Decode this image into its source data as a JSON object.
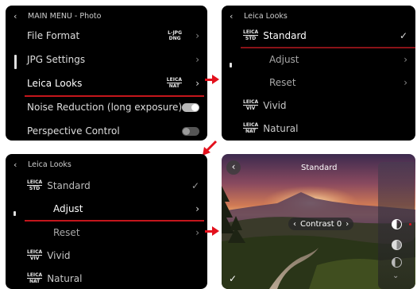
{
  "colors": {
    "accent_red": "#c4161c",
    "panel_bg": "#000000",
    "text": "#dedede"
  },
  "panel1": {
    "header": "MAIN MENU - Photo",
    "items": [
      {
        "label": "File Format",
        "value_top": "L-JPG",
        "value_bottom": "DNG",
        "control": "chevron"
      },
      {
        "label": "JPG Settings",
        "control": "chevron"
      },
      {
        "label": "Leica Looks",
        "value_top": "LEICA",
        "value_bottom": "NAT",
        "control": "chevron"
      },
      {
        "label": "Noise Reduction (long exposure)",
        "control": "toggle",
        "state": "on"
      },
      {
        "label": "Perspective Control",
        "control": "toggle",
        "state": "off"
      }
    ]
  },
  "panel2": {
    "header": "Leica Looks",
    "items": [
      {
        "label": "Standard",
        "badge_top": "LEICA",
        "badge_bottom": "STD",
        "control": "check"
      },
      {
        "label": "Adjust",
        "control": "chevron"
      },
      {
        "label": "Reset",
        "control": "chevron"
      },
      {
        "label": "Vivid",
        "badge_top": "LEICA",
        "badge_bottom": "VIV"
      },
      {
        "label": "Natural",
        "badge_top": "LEICA",
        "badge_bottom": "NAT"
      }
    ]
  },
  "panel3": {
    "header": "Leica Looks",
    "items": [
      {
        "label": "Standard",
        "badge_top": "LEICA",
        "badge_bottom": "STD",
        "control": "check"
      },
      {
        "label": "Adjust",
        "control": "chevron"
      },
      {
        "label": "Reset",
        "control": "chevron"
      },
      {
        "label": "Vivid",
        "badge_top": "LEICA",
        "badge_bottom": "VIV"
      },
      {
        "label": "Natural",
        "badge_top": "LEICA",
        "badge_bottom": "NAT"
      }
    ]
  },
  "panel4": {
    "title": "Standard",
    "control_label": "Contrast 0",
    "icons": [
      "back-icon",
      "contrast-icon",
      "saturation-icon",
      "sharpness-icon",
      "chevron-down-icon",
      "check-icon"
    ]
  }
}
